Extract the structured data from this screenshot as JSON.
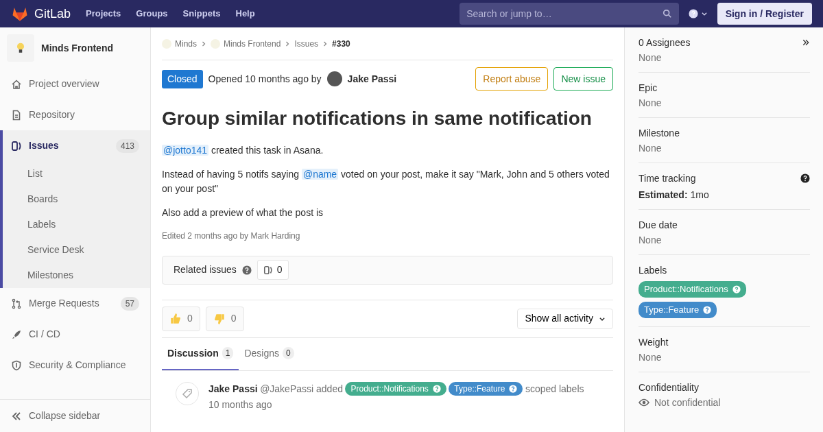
{
  "navbar": {
    "brand": "GitLab",
    "links": [
      "Projects",
      "Groups",
      "Snippets",
      "Help"
    ],
    "search": {
      "placeholder": "Search or jump to…"
    },
    "sign_in": "Sign in / Register"
  },
  "sidebar": {
    "project": "Minds Frontend",
    "items": [
      {
        "label": "Project overview",
        "selected": false
      },
      {
        "label": "Repository",
        "selected": false
      },
      {
        "label": "Issues",
        "count": "413",
        "selected": true,
        "children": [
          {
            "label": "List"
          },
          {
            "label": "Boards"
          },
          {
            "label": "Labels"
          },
          {
            "label": "Service Desk"
          },
          {
            "label": "Milestones"
          }
        ]
      },
      {
        "label": "Merge Requests",
        "count": "57",
        "selected": false
      },
      {
        "label": "CI / CD",
        "selected": false
      },
      {
        "label": "Security & Compliance",
        "selected": false
      }
    ],
    "collapse": "Collapse sidebar"
  },
  "breadcrumbs": [
    "Minds",
    "Minds Frontend",
    "Issues",
    "#330"
  ],
  "issue": {
    "status": "Closed",
    "opened": "Opened 10 months ago by",
    "author": "Jake Passi",
    "buttons": [
      {
        "label": "Report abuse",
        "kind": "warning"
      },
      {
        "label": "New issue",
        "kind": "success"
      }
    ],
    "title": "Group similar notifications in same notification",
    "paragraphs": [
      [
        {
          "kind": "mention",
          "text": "@jotto141"
        },
        {
          "kind": "text",
          "text": " created this task in Asana."
        }
      ],
      [
        {
          "kind": "text",
          "text": "Instead of having 5 notifs saying "
        },
        {
          "kind": "mention",
          "text": "@name"
        },
        {
          "kind": "text",
          "text": " voted on your post, make it say \"Mark, John and 5 others voted on your post\""
        }
      ],
      [
        {
          "kind": "text",
          "text": "Also add a preview of what the post is"
        }
      ]
    ],
    "edited": "Edited 2 months ago by Mark Harding",
    "related": {
      "label": "Related issues",
      "count": "0"
    },
    "awards": [
      {
        "kind": "thumbsup",
        "count": "0"
      },
      {
        "kind": "thumbsdown",
        "count": "0"
      }
    ],
    "activity_filter": "Show all activity",
    "tabs": [
      {
        "label": "Discussion",
        "count": "1",
        "selected": true
      },
      {
        "label": "Designs",
        "count": "0",
        "selected": false
      }
    ],
    "notes": [
      {
        "author": "Jake Passi",
        "handle": "@JakePassi",
        "action": "added",
        "labels": [
          {
            "text": "Product::Notifications",
            "color": "#44ad8e"
          },
          {
            "text": "Type::Feature",
            "color": "#428bca"
          }
        ],
        "suffix": "scoped labels",
        "time": "10 months ago"
      }
    ]
  },
  "right_sidebar": {
    "sections": [
      {
        "kind": "assignees",
        "title": "0 Assignees",
        "value": "None"
      },
      {
        "kind": "plain",
        "title": "Epic",
        "value": "None"
      },
      {
        "kind": "plain",
        "title": "Milestone",
        "value": "None"
      },
      {
        "kind": "time",
        "title": "Time tracking",
        "estimate_label": "Estimated:",
        "value": "1mo"
      },
      {
        "kind": "plain",
        "title": "Due date",
        "value": "None"
      },
      {
        "kind": "labels",
        "title": "Labels",
        "labels": [
          {
            "text": "Product::Notifications",
            "color": "#44ad8e"
          },
          {
            "text": "Type::Feature",
            "color": "#428bca"
          }
        ]
      },
      {
        "kind": "plain",
        "title": "Weight",
        "value": "None"
      },
      {
        "kind": "confidential",
        "title": "Confidentiality",
        "value": "Not confidential"
      }
    ]
  }
}
